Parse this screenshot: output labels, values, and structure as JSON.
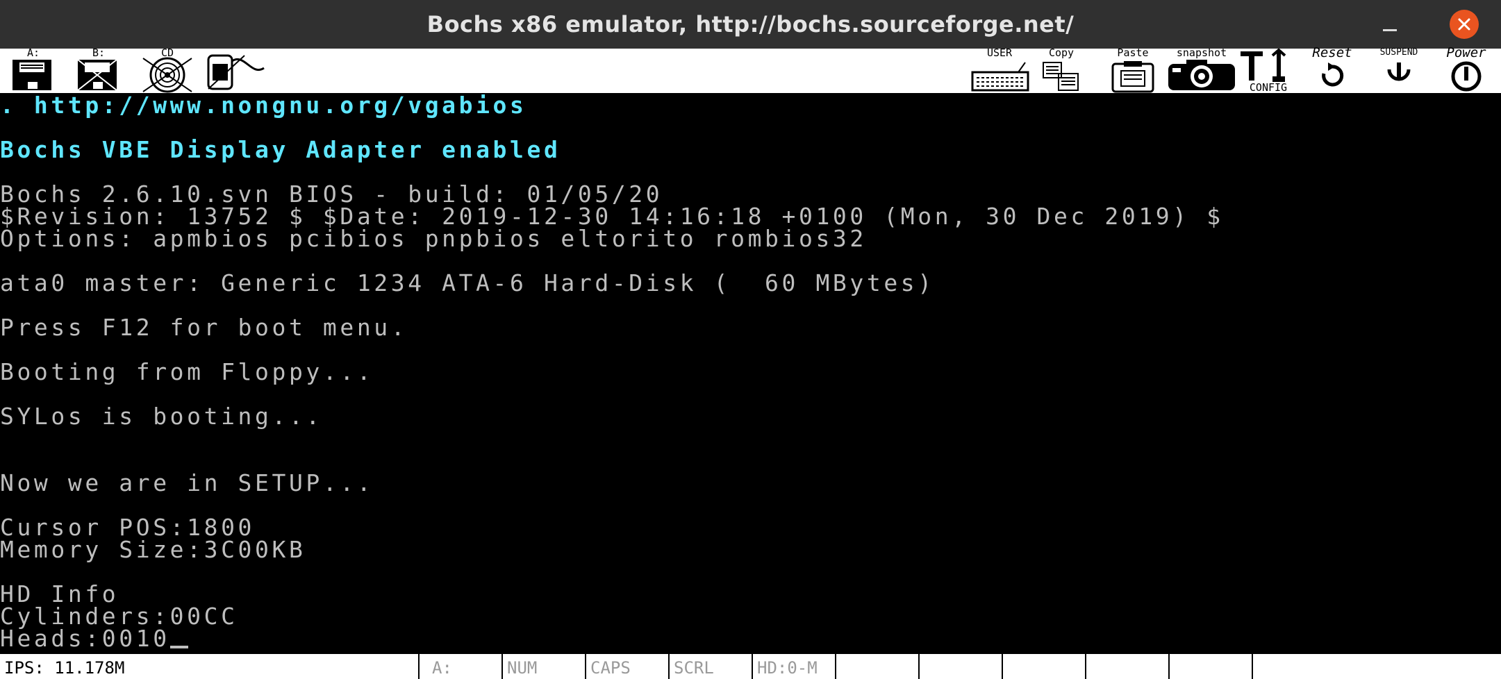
{
  "window": {
    "title": "Bochs x86 emulator, http://bochs.sourceforge.net/"
  },
  "toolbar": {
    "floppy_a_label": "A:",
    "floppy_b_label": "B:",
    "cdrom_label": "CD",
    "user_label": "USER",
    "copy_label": "Copy",
    "paste_label": "Paste",
    "snapshot_label": "snapshot",
    "config_label": "CONFIG",
    "reset_label": "Reset",
    "suspend_label": "SUSPEND",
    "power_label": "Power"
  },
  "screen": {
    "lines": [
      ". http://www.nongnu.org/vgabios",
      "Bochs VBE Display Adapter enabled",
      "Bochs 2.6.10.svn BIOS - build: 01/05/20",
      "$Revision: 13752 $ $Date: 2019-12-30 14:16:18 +0100 (Mon, 30 Dec 2019) $",
      "Options: apmbios pcibios pnpbios eltorito rombios32",
      "ata0 master: Generic 1234 ATA-6 Hard-Disk (  60 MBytes)",
      "Press F12 for boot menu.",
      "Booting from Floppy...",
      "SYLos is booting...",
      "Now we are in SETUP...",
      "Cursor POS:1800",
      "Memory Size:3C00KB",
      "HD Info",
      "Cylinders:00CC",
      "Heads:0010"
    ],
    "colors": {
      "cyan": "#5fe6ff",
      "grey": "#bebebe"
    }
  },
  "status": {
    "ips": "IPS: 11.178M",
    "a": "A:",
    "num": "NUM",
    "caps": "CAPS",
    "scrl": "SCRL",
    "hd": "HD:0-M"
  },
  "theme": {
    "close_button": "#e95420",
    "titlebar": "#303030"
  }
}
